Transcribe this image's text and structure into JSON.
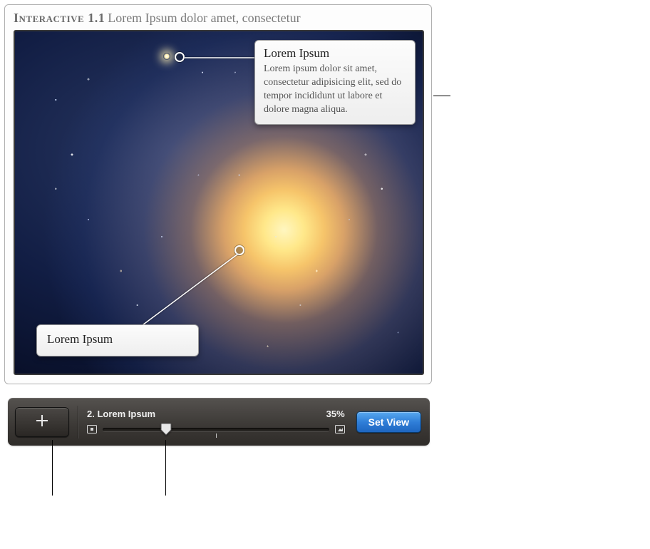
{
  "header": {
    "label": "Interactive 1.1",
    "caption": "Lorem Ipsum dolor amet, consectetur"
  },
  "callouts": {
    "c1": {
      "title": "Lorem Ipsum",
      "body": "Lorem ipsum dolor sit amet, consectetur adipisicing elit, sed do tempor incididunt ut labore et dolore magna aliqua."
    },
    "c2": {
      "title": "Lorem Ipsum"
    }
  },
  "toolbar": {
    "item_label": "2. Lorem Ipsum",
    "percent": "35%",
    "set_view_label": "Set View"
  }
}
